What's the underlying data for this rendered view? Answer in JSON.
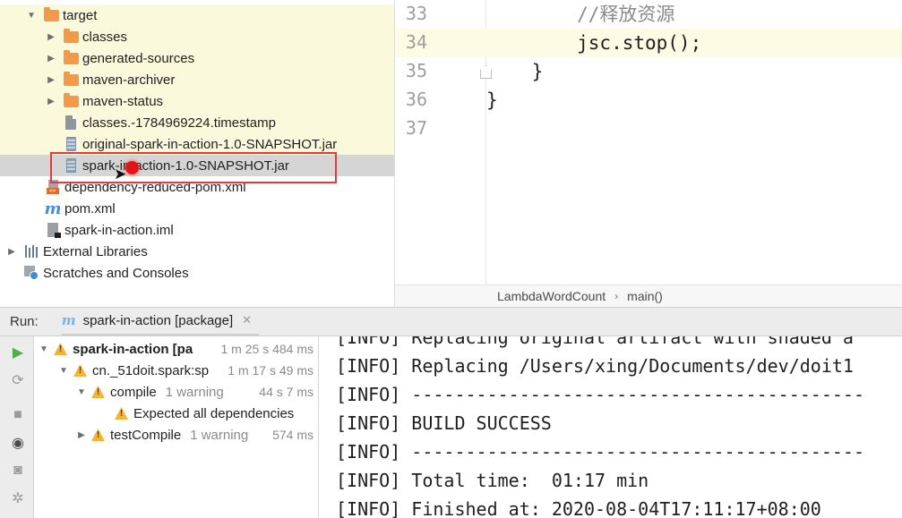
{
  "project_tree": {
    "items": [
      {
        "label": "target",
        "icon": "folder-icon"
      },
      {
        "label": "classes",
        "icon": "folder-icon"
      },
      {
        "label": "generated-sources",
        "icon": "folder-icon"
      },
      {
        "label": "maven-archiver",
        "icon": "folder-icon"
      },
      {
        "label": "maven-status",
        "icon": "folder-icon"
      },
      {
        "label": "classes.-1784969224.timestamp",
        "icon": "file-icon"
      },
      {
        "label": "original-spark-in-action-1.0-SNAPSHOT.jar",
        "icon": "jar-icon"
      },
      {
        "label": "spark-in-action-1.0-SNAPSHOT.jar",
        "icon": "jar-icon"
      },
      {
        "label": "dependency-reduced-pom.xml",
        "icon": "xml-icon"
      },
      {
        "label": "pom.xml",
        "icon": "maven-icon"
      },
      {
        "label": "spark-in-action.iml",
        "icon": "iml-icon"
      },
      {
        "label": "External Libraries",
        "icon": "libraries-icon"
      },
      {
        "label": "Scratches and Consoles",
        "icon": "scratches-icon"
      }
    ]
  },
  "editor": {
    "lines": [
      {
        "number": "33",
        "code": "        //释放资源"
      },
      {
        "number": "34",
        "code": "        jsc.stop();"
      },
      {
        "number": "35",
        "code": "    }"
      },
      {
        "number": "36",
        "code": "}"
      },
      {
        "number": "37",
        "code": ""
      }
    ],
    "breadcrumb": {
      "class_name": "LambdaWordCount",
      "method": "main()"
    }
  },
  "run_panel": {
    "label": "Run:",
    "tab_label": "spark-in-action [package]",
    "tree": [
      {
        "name": "spark-in-action [pa",
        "meta": "",
        "time": "1 m 25 s 484 ms"
      },
      {
        "name": "cn._51doit.spark:sp",
        "meta": "",
        "time": "1 m 17 s 49 ms"
      },
      {
        "name": "compile",
        "meta": "1 warning",
        "time": "44 s 7 ms"
      },
      {
        "name": "Expected all dependencies",
        "meta": "",
        "time": ""
      },
      {
        "name": "testCompile",
        "meta": "1 warning",
        "time": "574 ms"
      }
    ],
    "console_lines": [
      "[INFO] Replacing original artifact with shaded a",
      "[INFO] Replacing /Users/xing/Documents/dev/doit1",
      "[INFO] ------------------------------------------",
      "[INFO] BUILD SUCCESS",
      "[INFO] ------------------------------------------",
      "[INFO] Total time:  01:17 min",
      "[INFO] Finished at: 2020-08-04T17:11:17+08:00"
    ]
  },
  "colors": {
    "highlight_box": "#e33b3b",
    "tree_yellow": "#fbf9dc",
    "selected_row": "#d5d5d5",
    "warning": "#f2b53a",
    "folder": "#f29a4a"
  }
}
